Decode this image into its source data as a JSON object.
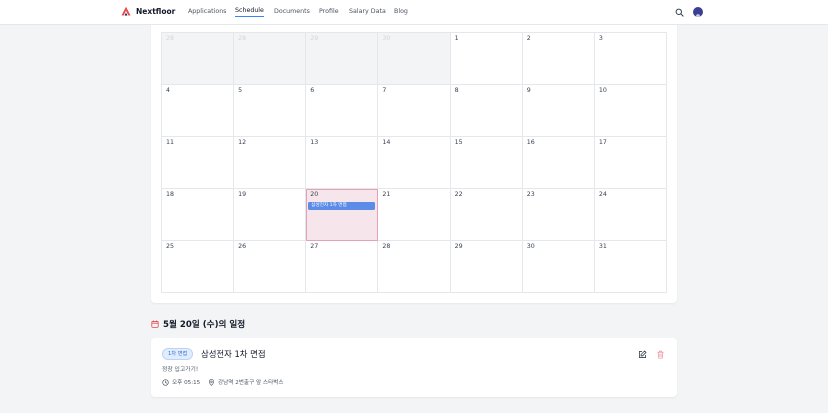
{
  "nav": {
    "brand": "Nextfloor",
    "brand_color": "#e5484d",
    "accent_color": "#3b82f6",
    "links": [
      {
        "label": "Applications",
        "active": false
      },
      {
        "label": "Schedule",
        "active": true
      },
      {
        "label": "Documents",
        "active": false
      },
      {
        "label": "Profile",
        "active": false
      },
      {
        "label": "Salary Data",
        "active": false
      },
      {
        "label": "Blog",
        "active": false
      }
    ],
    "icons": [
      "search-icon",
      "user-avatar"
    ]
  },
  "calendar": {
    "weeks": [
      [
        {
          "day": "28",
          "other": true
        },
        {
          "day": "28",
          "other": true
        },
        {
          "day": "29",
          "other": true
        },
        {
          "day": "30",
          "other": true
        },
        {
          "day": "1"
        },
        {
          "day": "2"
        },
        {
          "day": "3"
        }
      ],
      [
        {
          "day": "4"
        },
        {
          "day": "5"
        },
        {
          "day": "6"
        },
        {
          "day": "7"
        },
        {
          "day": "8"
        },
        {
          "day": "9"
        },
        {
          "day": "10"
        }
      ],
      [
        {
          "day": "11"
        },
        {
          "day": "12"
        },
        {
          "day": "13"
        },
        {
          "day": "14"
        },
        {
          "day": "15"
        },
        {
          "day": "16"
        },
        {
          "day": "17"
        }
      ],
      [
        {
          "day": "18"
        },
        {
          "day": "19"
        },
        {
          "day": "20",
          "selected": true,
          "events": [
            "삼성전자 1차 면접"
          ]
        },
        {
          "day": "21"
        },
        {
          "day": "22"
        },
        {
          "day": "23"
        },
        {
          "day": "24"
        }
      ],
      [
        {
          "day": "25"
        },
        {
          "day": "26"
        },
        {
          "day": "27"
        },
        {
          "day": "28"
        },
        {
          "day": "29"
        },
        {
          "day": "30"
        },
        {
          "day": "31"
        }
      ]
    ],
    "event_color": "#5b8ce8",
    "selected_color": "#f6e5ea"
  },
  "schedule": {
    "title": "5월 20일 (수)의 일정",
    "title_icon": "calendar-icon",
    "title_icon_color": "#e5484d",
    "events": [
      {
        "badge": "1차 면접",
        "title": "삼성전자 1차 면접",
        "description": "정장 입고가기!",
        "time": "오후 05:15",
        "location": "강남역 2번출구 앞 스타벅스",
        "icons": [
          "clock-icon",
          "location-pin-icon",
          "edit-icon",
          "trash-icon"
        ]
      }
    ]
  }
}
